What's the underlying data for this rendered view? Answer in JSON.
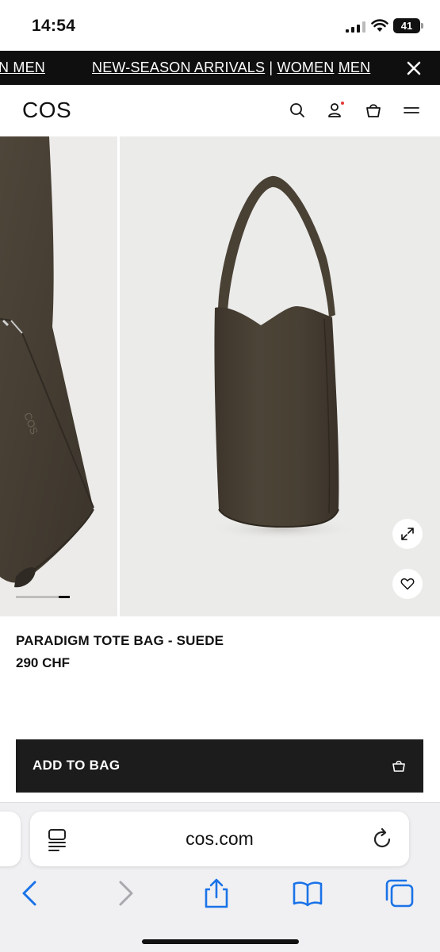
{
  "status_bar": {
    "time": "14:54",
    "battery": "41",
    "icons": [
      "signal-icon",
      "wifi-icon",
      "battery-icon"
    ]
  },
  "promo_banner": {
    "left_fragment": "N MEN",
    "headline": "NEW-SEASON ARRIVALS",
    "separator": "|",
    "link_women": "WOMEN",
    "link_men": "MEN",
    "close_icon": "close-icon"
  },
  "header": {
    "logo": "COS",
    "icons": [
      "search-icon",
      "account-icon",
      "shopping-bag-icon",
      "menu-icon"
    ],
    "account_notification_color": "#e53935"
  },
  "gallery": {
    "image_count": 2,
    "active_index": 1,
    "expand_icon": "expand-icon",
    "wishlist_icon": "heart-icon",
    "bag_color": "#4a4135",
    "background_color": "#ebebea"
  },
  "product": {
    "name": "PARADIGM TOTE BAG - SUEDE",
    "price": "290 CHF"
  },
  "add_to_bag": {
    "label": "ADD TO BAG",
    "icon": "shopping-bag-icon"
  },
  "browser": {
    "url": "cos.com",
    "toolbar_icons": [
      "back-icon",
      "forward-icon",
      "share-icon",
      "bookmarks-icon",
      "tabs-icon"
    ],
    "accent_color": "#1a73e8"
  }
}
